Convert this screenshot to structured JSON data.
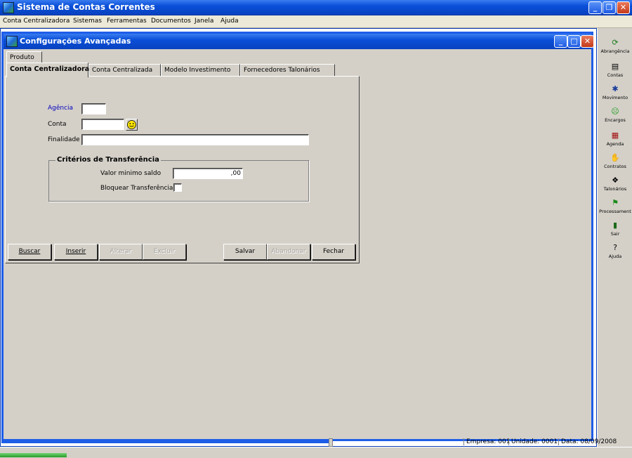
{
  "app": {
    "title": "Sistema de Contas Correntes"
  },
  "menu": [
    "Conta Centralizadora",
    "Sistemas",
    "Ferramentas",
    "Documentos",
    "Janela",
    "Ajuda"
  ],
  "window": {
    "title": "Configurações Avançadas"
  },
  "tabs_top": [
    "Produto"
  ],
  "tabs": [
    "Conta Centralizadora",
    "Conta Centralizada",
    "Modelo Investimento",
    "Fornecedores Talonários"
  ],
  "active_tab": "Conta Centralizadora",
  "form": {
    "agencia_label": "Agência",
    "agencia_value": "",
    "conta_label": "Conta",
    "conta_value": "",
    "finalidade_label": "Finalidade",
    "finalidade_value": "",
    "group_title": "Critérios de Transferência",
    "valor_label": "Valor minimo saldo",
    "valor_value": ",00",
    "bloquear_label": "Bloquear Transferência",
    "bloquear_checked": false
  },
  "buttons": {
    "buscar": "Buscar",
    "inserir": "Inserir",
    "alterar": "Alterar",
    "excluir": "Excluir",
    "salvar": "Salvar",
    "abandonar": "Abandonar",
    "fechar": "Fechar"
  },
  "toolbar": [
    {
      "label": "Abrangência",
      "icon": "globe-icon"
    },
    {
      "label": "Contas",
      "icon": "accounts-icon"
    },
    {
      "label": "Movimento",
      "icon": "runner-icon"
    },
    {
      "label": "Encargos",
      "icon": "sad-face-icon"
    },
    {
      "label": "Agenda",
      "icon": "calendar-icon"
    },
    {
      "label": "Contratos",
      "icon": "handshake-icon"
    },
    {
      "label": "Talonários",
      "icon": "checkbook-icon"
    },
    {
      "label": "Processament",
      "icon": "flag-icon"
    },
    {
      "label": "Sair",
      "icon": "exit-door-icon"
    },
    {
      "label": "Ajuda",
      "icon": "help-icon"
    }
  ],
  "status": {
    "empresa": "Empresa: 001",
    "unidade": "Unidade: 0001",
    "data": "Data:  08/09/2008"
  },
  "colors": {
    "titlebar": "#0a4fd8",
    "agencia_label": "#0000c0",
    "workspace": "#ffffff"
  }
}
